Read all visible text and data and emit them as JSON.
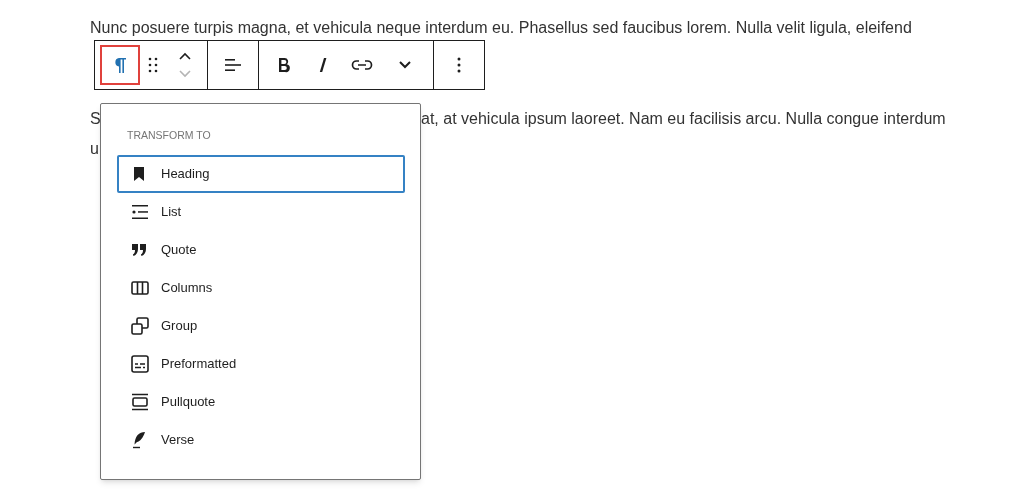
{
  "paragraph_above": "Nunc posuere turpis magna, et vehicula neque interdum eu. Phasellus sed faucibus lorem. Nulla velit ligula, eleifend",
  "toolbar": {
    "groups": [
      [
        {
          "kind": "paragraph",
          "highlighted": true
        },
        {
          "kind": "drag",
          "highlighted": false
        },
        {
          "kind": "move-up",
          "highlighted": false,
          "disabled": false
        },
        {
          "kind": "move-down",
          "highlighted": false,
          "disabled": true
        }
      ],
      [
        {
          "kind": "align",
          "highlighted": false
        }
      ],
      [
        {
          "kind": "bold",
          "highlighted": false
        },
        {
          "kind": "italic",
          "highlighted": false
        },
        {
          "kind": "link",
          "highlighted": false
        },
        {
          "kind": "more",
          "highlighted": false
        }
      ],
      [
        {
          "kind": "options",
          "highlighted": false
        }
      ]
    ]
  },
  "paragraph_below": {
    "line_1_start": "S",
    "line_1_end": "at, at vehicula ipsum laoreet. Nam eu facilisis arcu. Nulla congue interdum",
    "line_2_start": "u"
  },
  "transform_menu": {
    "heading": "TRANSFORM TO",
    "items": [
      {
        "kind": "heading",
        "label": "Heading",
        "selected": true
      },
      {
        "kind": "list",
        "label": "List",
        "selected": false
      },
      {
        "kind": "quote",
        "label": "Quote",
        "selected": false
      },
      {
        "kind": "columns",
        "label": "Columns",
        "selected": false
      },
      {
        "kind": "group",
        "label": "Group",
        "selected": false
      },
      {
        "kind": "preformatted",
        "label": "Preformatted",
        "selected": false
      },
      {
        "kind": "pullquote",
        "label": "Pullquote",
        "selected": false
      },
      {
        "kind": "verse",
        "label": "Verse",
        "selected": false
      }
    ]
  }
}
